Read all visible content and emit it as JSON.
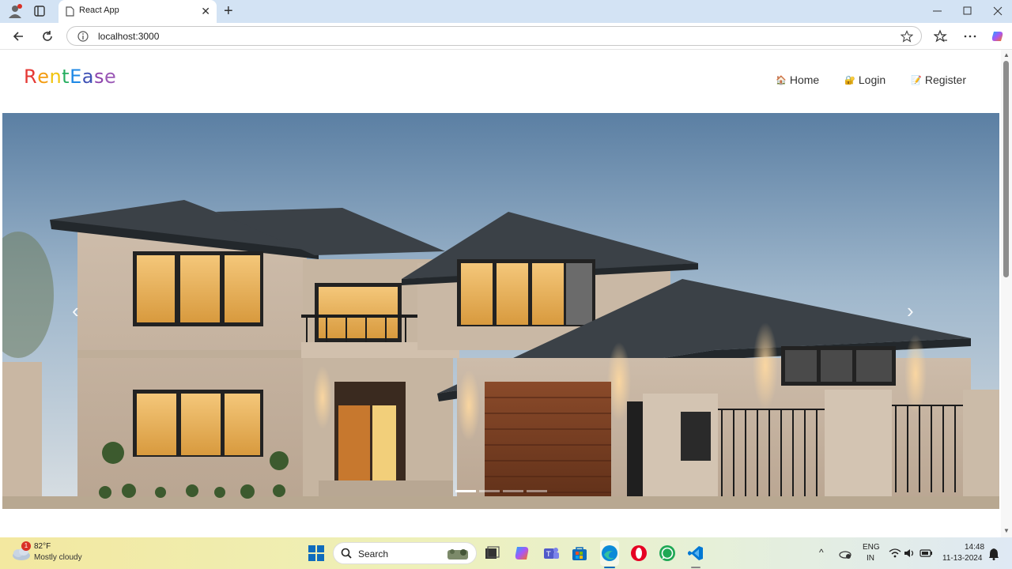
{
  "browser": {
    "tab_title": "React App",
    "url": "localhost:3000"
  },
  "site": {
    "brand_letters": [
      {
        "ch": "R",
        "color": "#e53935"
      },
      {
        "ch": "e",
        "color": "#f39c12"
      },
      {
        "ch": "n",
        "color": "#f1c40f"
      },
      {
        "ch": "t",
        "color": "#27ae60"
      },
      {
        "ch": "E",
        "color": "#1e88e5"
      },
      {
        "ch": "a",
        "color": "#3f51b5"
      },
      {
        "ch": "s",
        "color": "#8e44ad"
      },
      {
        "ch": "e",
        "color": "#9b59b6"
      }
    ],
    "nav": [
      {
        "icon": "🏠",
        "label": "Home"
      },
      {
        "icon": "🔐",
        "label": "Login"
      },
      {
        "icon": "📝",
        "label": "Register"
      }
    ],
    "carousel": {
      "slide_count": 4,
      "active_index": 0,
      "prev_glyph": "‹",
      "next_glyph": "›"
    }
  },
  "taskbar": {
    "weather_badge": "1",
    "temperature": "82°F",
    "condition": "Mostly cloudy",
    "search_label": "Search",
    "language": "ENG",
    "region": "IN",
    "time": "14:48",
    "date": "11-13-2024"
  }
}
